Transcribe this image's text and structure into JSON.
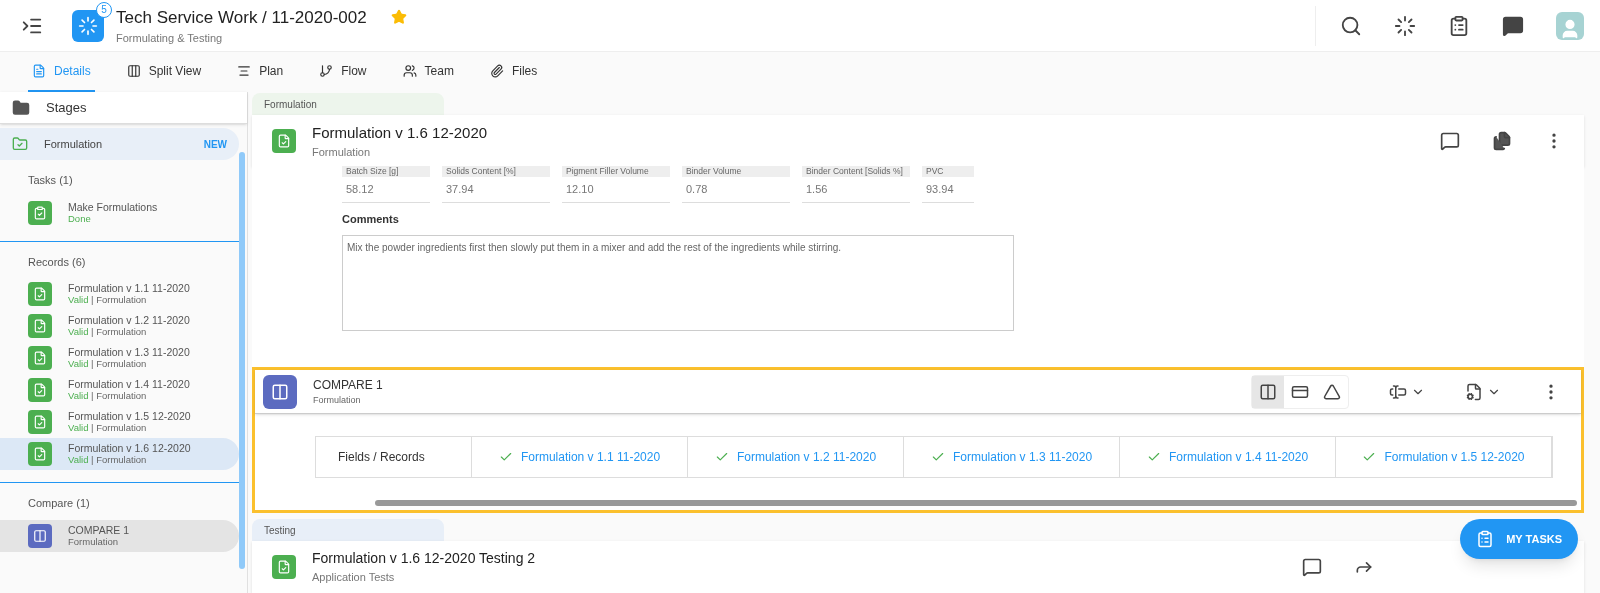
{
  "header": {
    "badge": "5",
    "title": "Tech Service Work / 11-2020-002",
    "subtitle": "Formulating & Testing",
    "starred": true
  },
  "tabs": [
    {
      "label": "Details",
      "selected": true
    },
    {
      "label": "Split View",
      "selected": false
    },
    {
      "label": "Plan",
      "selected": false
    },
    {
      "label": "Flow",
      "selected": false
    },
    {
      "label": "Team",
      "selected": false
    },
    {
      "label": "Files",
      "selected": false
    }
  ],
  "sidebar": {
    "title": "Stages",
    "stage": {
      "label": "Formulation",
      "badge": "NEW",
      "selected": true
    },
    "sections": [
      {
        "heading": "Tasks (1)",
        "items": [
          {
            "kind": "task",
            "title": "Make Formulations",
            "status": "Done",
            "selected": false
          }
        ]
      },
      {
        "heading": "Records (6)",
        "items": [
          {
            "kind": "record",
            "title": "Formulation v 1.1 11-2020",
            "status": "Valid",
            "type": "| Formulation",
            "selected": false
          },
          {
            "kind": "record",
            "title": "Formulation v 1.2 11-2020",
            "status": "Valid",
            "type": "| Formulation",
            "selected": false
          },
          {
            "kind": "record",
            "title": "Formulation v 1.3 11-2020",
            "status": "Valid",
            "type": "| Formulation",
            "selected": false
          },
          {
            "kind": "record",
            "title": "Formulation v 1.4 11-2020",
            "status": "Valid",
            "type": "| Formulation",
            "selected": false
          },
          {
            "kind": "record",
            "title": "Formulation v 1.5 12-2020",
            "status": "Valid",
            "type": "| Formulation",
            "selected": false
          },
          {
            "kind": "record",
            "title": "Formulation v 1.6 12-2020",
            "status": "Valid",
            "type": "| Formulation",
            "selected": true
          }
        ]
      },
      {
        "heading": "Compare (1)",
        "items": [
          {
            "kind": "compare",
            "title": "COMPARE 1",
            "type": "Formulation",
            "selected": true
          }
        ]
      }
    ]
  },
  "main": {
    "group_1": "Formulation",
    "record": {
      "title": "Formulation v 1.6 12-2020",
      "subtitle": "Formulation"
    },
    "fields": [
      {
        "label": "Batch Size [g]",
        "value": "58.12"
      },
      {
        "label": "Solids Content [%]",
        "value": "37.94"
      },
      {
        "label": "Pigment Filler Volume",
        "value": "12.10"
      },
      {
        "label": "Binder Volume",
        "value": "0.78"
      },
      {
        "label": "Binder Content [Solids %]",
        "value": "1.56"
      },
      {
        "label": "PVC",
        "value": "93.94"
      }
    ],
    "comments": {
      "label": "Comments",
      "value": "Mix the powder ingredients first then slowly put them in a mixer and add the rest of the ingredients while stirring."
    },
    "compare": {
      "title": "COMPARE 1",
      "subtitle": "Formulation",
      "highlighted": true,
      "columns": [
        "Fields / Records",
        "Formulation v 1.1 11-2020",
        "Formulation v 1.2 11-2020",
        "Formulation v 1.3 11-2020",
        "Formulation v 1.4 11-2020",
        "Formulation v 1.5 12-2020"
      ]
    },
    "group_2": "Testing",
    "record_2": {
      "title": "Formulation v 1.6 12-2020 Testing 2",
      "subtitle": "Application Tests"
    }
  },
  "fab": "MY TASKS"
}
